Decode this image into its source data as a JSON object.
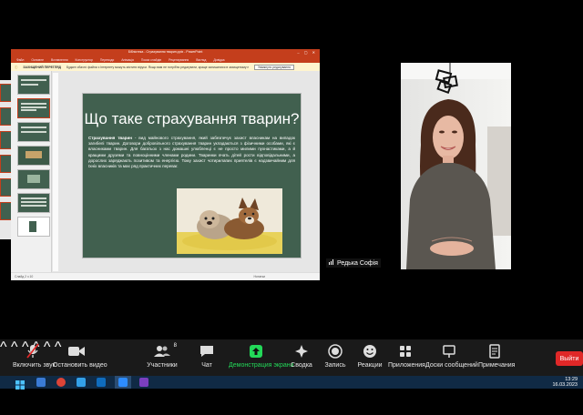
{
  "powerpoint": {
    "window_title": "Бібліотека - Страхування тварин.pptx - PowerPoint",
    "menu": [
      "Файл",
      "Основне",
      "Вставлення",
      "Конструктор",
      "Переходи",
      "Анімація",
      "Показ слайдів",
      "Рецензування",
      "Вигляд",
      "Довідка"
    ],
    "banner_label": "ЗАХИЩЕНИЙ ПЕРЕГЛЯД",
    "banner_text": "Будьте обачні: файли з Інтернету можуть містити віруси. Якщо вам не потрібно редагувати, краще залишатися в захищеному перегляді.",
    "banner_button": "Увімкнути редагування",
    "status_left": "Слайд 2 з 10",
    "status_right": "Нотатки",
    "slide": {
      "title": "Що таке страхування тварин?",
      "term": "Страхування тварин",
      "body": " - вид майнового страхування, який забезпечує захист власникам на випадок загибелі тварин. Договори добровільного страхування тварин укладаються з фізичними особами, які є власниками тварин. Для багатьох з нас домашні улюбленці є не просто милими пухнастиками, а й кращими друзями та повноцінними членами родини. Тваринки вчать дітей рости відповідальними, а дорослих заряджають позитивом та енергією. Тому захист чотирилапих приятелів є надзвичайним для їхніх власників та має ряд практичних переваг."
    }
  },
  "participant": {
    "name": "Редька Софія"
  },
  "toolbar": {
    "mute": "Включить звук",
    "video": "Остановить видео",
    "participants": "Участники",
    "participants_count": "8",
    "chat": "Чат",
    "share": "Демонстрация экрана",
    "summary": "Сводка",
    "record": "Запись",
    "reactions": "Реакции",
    "apps": "Приложения",
    "whiteboards": "Доски сообщений",
    "notes": "Примечания",
    "leave": "Выйти"
  },
  "taskbar": {
    "time": "13:29",
    "date": "16.03.2023"
  },
  "colors": {
    "ppt_accent": "#c43e1c",
    "slide_bg": "#41604f",
    "share_green": "#23d959",
    "leave_red": "#e02828"
  }
}
